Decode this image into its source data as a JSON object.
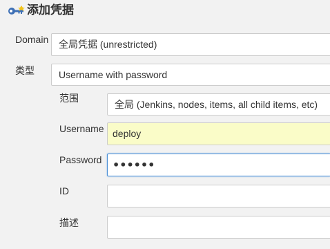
{
  "header": {
    "title": "添加凭据",
    "icon": "key-icon"
  },
  "form": {
    "domain": {
      "label": "Domain",
      "value": "全局凭据 (unrestricted)"
    },
    "kind": {
      "label": "类型",
      "value": "Username with password"
    },
    "scope": {
      "label": "范围",
      "value": "全局 (Jenkins, nodes, items, all child items, etc)"
    },
    "username": {
      "label": "Username",
      "value": "deploy"
    },
    "password": {
      "label": "Password",
      "value": "••••••"
    },
    "id": {
      "label": "ID",
      "value": ""
    },
    "description": {
      "label": "描述",
      "value": ""
    }
  },
  "colors": {
    "background": "#f2f2f2",
    "field_border": "#cccccc",
    "autofill": "#fafcc8",
    "focus": "#4b90d6",
    "key_icon_blue": "#3d6fb5",
    "key_icon_yellow": "#f2c316"
  }
}
